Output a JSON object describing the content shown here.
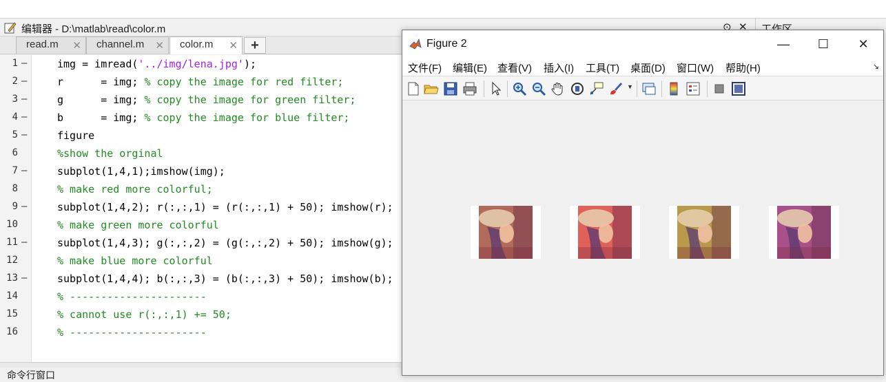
{
  "editor": {
    "title": "编辑器 - D:\\matlab\\read\\color.m",
    "tabs": [
      {
        "label": "read.m",
        "close": "✕"
      },
      {
        "label": "channel.m",
        "close": "✕"
      },
      {
        "label": "color.m",
        "close": "✕"
      }
    ],
    "add_tab": "+",
    "header_controls": {
      "menu": "⊙",
      "close": "✕"
    },
    "lines": [
      {
        "num": "1",
        "dash": "—",
        "segments": [
          {
            "t": "img = imread(",
            "c": "n"
          },
          {
            "t": "'../img/lena.jpg'",
            "c": "s"
          },
          {
            "t": ");",
            "c": "n"
          }
        ]
      },
      {
        "num": "2",
        "dash": "—",
        "segments": [
          {
            "t": "r      = img; ",
            "c": "n"
          },
          {
            "t": "% copy the image for red filter;",
            "c": "c"
          }
        ]
      },
      {
        "num": "3",
        "dash": "—",
        "segments": [
          {
            "t": "g      = img; ",
            "c": "n"
          },
          {
            "t": "% copy the image for green filter;",
            "c": "c"
          }
        ]
      },
      {
        "num": "4",
        "dash": "—",
        "segments": [
          {
            "t": "b      = img; ",
            "c": "n"
          },
          {
            "t": "% copy the image for blue filter;",
            "c": "c"
          }
        ]
      },
      {
        "num": "5",
        "dash": "—",
        "segments": [
          {
            "t": "figure",
            "c": "n"
          }
        ]
      },
      {
        "num": "6",
        "dash": "",
        "segments": [
          {
            "t": "%show the orginal",
            "c": "c"
          }
        ]
      },
      {
        "num": "7",
        "dash": "—",
        "segments": [
          {
            "t": "subplot(1,4,1);imshow(img);",
            "c": "n"
          }
        ]
      },
      {
        "num": "8",
        "dash": "",
        "segments": [
          {
            "t": "% make red more colorful;",
            "c": "c"
          }
        ]
      },
      {
        "num": "9",
        "dash": "—",
        "segments": [
          {
            "t": "subplot(1,4,2); r(:,:,1) = (r(:,:,1) + 50); imshow(r);",
            "c": "n"
          }
        ]
      },
      {
        "num": "10",
        "dash": "",
        "segments": [
          {
            "t": "% make green more colorful",
            "c": "c"
          }
        ]
      },
      {
        "num": "11",
        "dash": "—",
        "segments": [
          {
            "t": "subplot(1,4,3); g(:,:,2) = (g(:,:,2) + 50); imshow(g);",
            "c": "n"
          }
        ]
      },
      {
        "num": "12",
        "dash": "",
        "segments": [
          {
            "t": "% make blue more colorful",
            "c": "c"
          }
        ]
      },
      {
        "num": "13",
        "dash": "—",
        "segments": [
          {
            "t": "subplot(1,4,4); b(:,:,3) = (b(:,:,3) + 50); imshow(b);",
            "c": "n"
          }
        ]
      },
      {
        "num": "14",
        "dash": "",
        "segments": [
          {
            "t": "% ----------------------",
            "c": "c"
          }
        ]
      },
      {
        "num": "15",
        "dash": "",
        "segments": [
          {
            "t": "% cannot use r(:,:,1) += 50;",
            "c": "c"
          }
        ]
      },
      {
        "num": "16",
        "dash": "",
        "segments": [
          {
            "t": "% ----------------------",
            "c": "c"
          }
        ]
      }
    ],
    "command_window_label": "命令行窗口"
  },
  "workspace": {
    "title": "工作区"
  },
  "figure": {
    "title": "Figure 2",
    "window_buttons": {
      "minimize": "—",
      "maximize": "☐",
      "close": "✕"
    },
    "menus": [
      "文件(F)",
      "编辑(E)",
      "查看(V)",
      "插入(I)",
      "工具(T)",
      "桌面(D)",
      "窗口(W)",
      "帮助(H)"
    ],
    "menu_overflow": "↘",
    "toolbar_icons": [
      "new-file-icon",
      "open-folder-icon",
      "save-icon",
      "print-icon",
      "pointer-icon",
      "zoom-in-icon",
      "zoom-out-icon",
      "pan-hand-icon",
      "rotate-3d-icon",
      "data-cursor-icon",
      "brush-icon",
      "link-plot-icon",
      "colorbar-icon",
      "legend-icon",
      "hide-plot-tools-icon",
      "show-plot-tools-icon"
    ],
    "subplots": [
      {
        "name": "original",
        "tint": "#b26a5a"
      },
      {
        "name": "red-enhanced",
        "tint": "#e0605a"
      },
      {
        "name": "green-enhanced",
        "tint": "#b89a4a"
      },
      {
        "name": "blue-enhanced",
        "tint": "#a8508a"
      }
    ]
  },
  "colors": {
    "comment": "#228b22",
    "string": "#a020f0",
    "keyword": "#000000"
  }
}
